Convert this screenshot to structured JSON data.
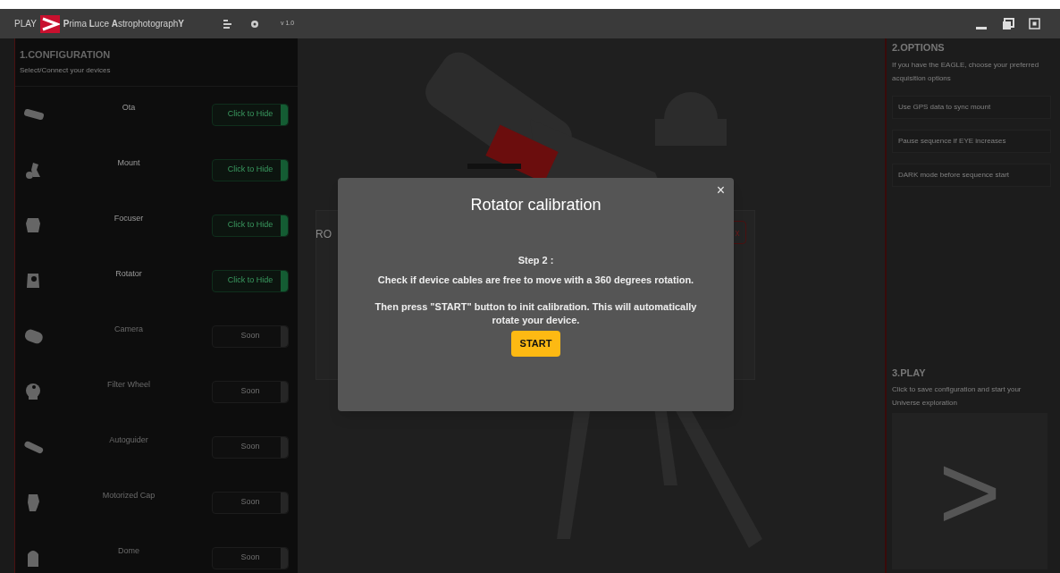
{
  "titlebar": {
    "brand": "PLAY",
    "app_name": "**P**rima **L**uce **A**strophotograph**Y**",
    "version": "v 1.0"
  },
  "configuration": {
    "title": "1.CONFIGURATION",
    "subtitle": "Select/Connect your devices",
    "devices": [
      {
        "name": "Ota",
        "button": "Click to Hide",
        "connected": true
      },
      {
        "name": "Mount",
        "button": "Click to Hide",
        "connected": true
      },
      {
        "name": "Focuser",
        "button": "Click to Hide",
        "connected": true
      },
      {
        "name": "Rotator",
        "button": "Click to Hide",
        "connected": true
      },
      {
        "name": "Camera",
        "button": "Soon",
        "connected": false
      },
      {
        "name": "Filter Wheel",
        "button": "Soon",
        "connected": false
      },
      {
        "name": "Autoguider",
        "button": "Soon",
        "connected": false
      },
      {
        "name": "Motorized Cap",
        "button": "Soon",
        "connected": false
      },
      {
        "name": "Dome",
        "button": "Soon",
        "connected": false
      }
    ]
  },
  "background_panel": {
    "title": "RO",
    "close": "x"
  },
  "dialog": {
    "title": "Rotator calibration",
    "close": "×",
    "step": "Step 2 :",
    "instruction": "Check if device cables are free to move with a 360 degrees rotation.",
    "note": "Then press \"START\" button to init calibration. This will automatically rotate your device.",
    "button": "START"
  },
  "options": {
    "title": "2.OPTIONS",
    "subtitle": "If you have the EAGLE, choose your preferred acquisition options",
    "items": [
      "Use GPS data to sync mount",
      "Pause sequence if EYE increases",
      "DARK mode before sequence start"
    ]
  },
  "play": {
    "title": "3.PLAY",
    "subtitle": "Click to save configuration and start your Universe exploration",
    "button": ">"
  }
}
